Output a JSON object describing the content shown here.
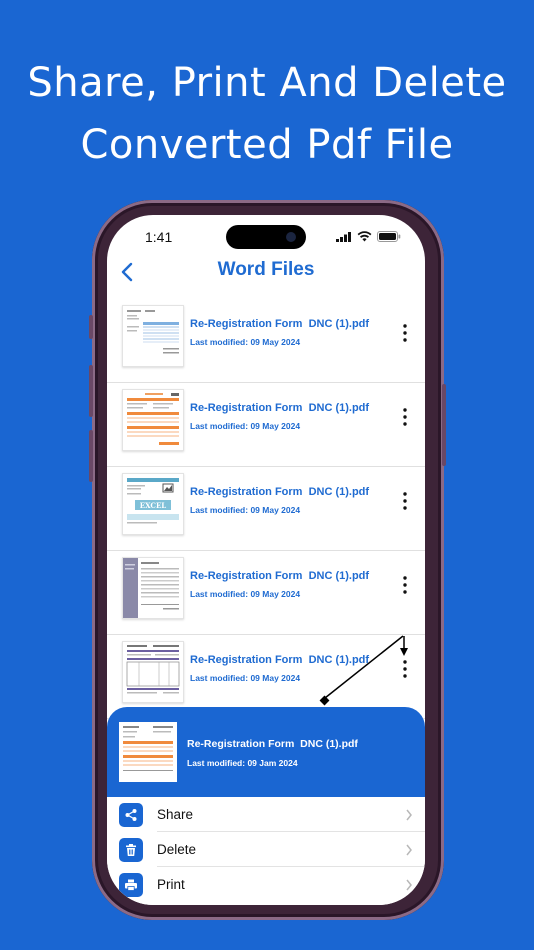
{
  "headline": {
    "line1": "Share, Print And Delete",
    "line2": "Converted Pdf File"
  },
  "status_bar": {
    "time": "1:41"
  },
  "nav": {
    "title": "Word Files",
    "back_icon": "chevron-left-icon"
  },
  "files": [
    {
      "name": "Re-Registration Form  DNC (1).pdf",
      "modified": "Last modified: 09 May 2024"
    },
    {
      "name": "Re-Registration Form  DNC (1).pdf",
      "modified": "Last modified: 09 May 2024"
    },
    {
      "name": "Re-Registration Form  DNC (1).pdf",
      "modified": "Last modified: 09 May 2024",
      "thumb_badge": "EXCEL"
    },
    {
      "name": "Re-Registration Form  DNC (1).pdf",
      "modified": "Last modified: 09 May 2024"
    },
    {
      "name": "Re-Registration Form  DNC (1).pdf",
      "modified": "Last modified: 09 May 2024"
    }
  ],
  "sheet": {
    "file_name": "Re-Registration Form  DNC (1).pdf",
    "file_modified": "Last modified: 09 Jam 2024",
    "actions": [
      {
        "label": "Share",
        "icon": "share-icon"
      },
      {
        "label": "Delete",
        "icon": "trash-icon"
      },
      {
        "label": "Print",
        "icon": "printer-icon"
      }
    ]
  },
  "colors": {
    "background": "#1a66d2",
    "accent": "#1f6bd1",
    "phone_frame": "#3d2438"
  }
}
